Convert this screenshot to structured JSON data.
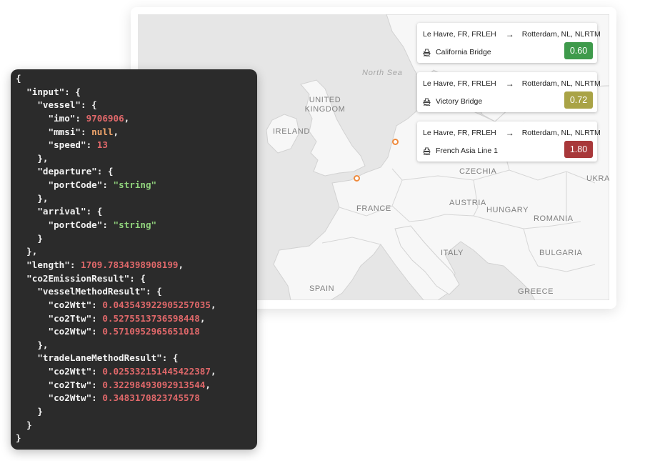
{
  "map": {
    "labels": {
      "north_sea": "North Sea",
      "united_kingdom": "UNITED KINGDOM",
      "ireland": "IRELAND",
      "france": "FRANCE",
      "spain": "SPAIN",
      "italy": "ITALY",
      "czechia": "CZECHIA",
      "austria": "AUSTRIA",
      "hungary": "HUNGARY",
      "romania": "ROMANIA",
      "bulgaria": "BULGARIA",
      "greece": "GREECE",
      "ukraine_partial": "UKRA"
    },
    "marker_color": "#ef8a3c"
  },
  "routes": [
    {
      "from": "Le Havre, FR, FRLEH",
      "arrow": "→",
      "to": "Rotterdam, NL, NLRTM",
      "vessel": "California Bridge",
      "score": "0.60",
      "score_color": "#3e9a4b",
      "icon": "ship-icon"
    },
    {
      "from": "Le Havre, FR, FRLEH",
      "arrow": "→",
      "to": "Rotterdam, NL, NLRTM",
      "vessel": "Victory Bridge",
      "score": "0.72",
      "score_color": "#a9a346",
      "icon": "ship-icon"
    },
    {
      "from": "Le Havre, FR, FRLEH",
      "arrow": "→",
      "to": "Rotterdam, NL, NLRTM",
      "vessel": "French Asia Line 1",
      "score": "1.80",
      "score_color": "#a8383a",
      "icon": "ship-icon"
    }
  ],
  "code": {
    "colors": {
      "key": "#f2f2f2",
      "number": "#e0686a",
      "string": "#8fd17c",
      "literal": "#f0a56b"
    },
    "lines": [
      [
        {
          "t": "{",
          "c": "k"
        }
      ],
      [
        {
          "t": "  \"input\": {",
          "c": "k"
        }
      ],
      [
        {
          "t": "    \"vessel\": {",
          "c": "k"
        }
      ],
      [
        {
          "t": "      \"imo\": ",
          "c": "k"
        },
        {
          "t": "9706906",
          "c": "n"
        },
        {
          "t": ",",
          "c": "k"
        }
      ],
      [
        {
          "t": "      \"mmsi\": ",
          "c": "k"
        },
        {
          "t": "null",
          "c": "l"
        },
        {
          "t": ",",
          "c": "k"
        }
      ],
      [
        {
          "t": "      \"speed\": ",
          "c": "k"
        },
        {
          "t": "13",
          "c": "n"
        }
      ],
      [
        {
          "t": "    },",
          "c": "k"
        }
      ],
      [
        {
          "t": "    \"departure\": {",
          "c": "k"
        }
      ],
      [
        {
          "t": "      \"portCode\": ",
          "c": "k"
        },
        {
          "t": "\"string\"",
          "c": "s"
        }
      ],
      [
        {
          "t": "    },",
          "c": "k"
        }
      ],
      [
        {
          "t": "    \"arrival\": {",
          "c": "k"
        }
      ],
      [
        {
          "t": "      \"portCode\": ",
          "c": "k"
        },
        {
          "t": "\"string\"",
          "c": "s"
        }
      ],
      [
        {
          "t": "    }",
          "c": "k"
        }
      ],
      [
        {
          "t": "  },",
          "c": "k"
        }
      ],
      [
        {
          "t": "  \"length\": ",
          "c": "k"
        },
        {
          "t": "1709.7834398908199",
          "c": "n"
        },
        {
          "t": ",",
          "c": "k"
        }
      ],
      [
        {
          "t": "  \"co2EmissionResult\": {",
          "c": "k"
        }
      ],
      [
        {
          "t": "    \"vesselMethodResult\": {",
          "c": "k"
        }
      ],
      [
        {
          "t": "      \"co2Wtt\": ",
          "c": "k"
        },
        {
          "t": "0.043543922905257035",
          "c": "n"
        },
        {
          "t": ",",
          "c": "k"
        }
      ],
      [
        {
          "t": "      \"co2Ttw\": ",
          "c": "k"
        },
        {
          "t": "0.5275513736598448",
          "c": "n"
        },
        {
          "t": ",",
          "c": "k"
        }
      ],
      [
        {
          "t": "      \"co2Wtw\": ",
          "c": "k"
        },
        {
          "t": "0.5710952965651018",
          "c": "n"
        }
      ],
      [
        {
          "t": "    },",
          "c": "k"
        }
      ],
      [
        {
          "t": "    \"tradeLaneMethodResult\": {",
          "c": "k"
        }
      ],
      [
        {
          "t": "      \"co2Wtt\": ",
          "c": "k"
        },
        {
          "t": "0.025332151445422387",
          "c": "n"
        },
        {
          "t": ",",
          "c": "k"
        }
      ],
      [
        {
          "t": "      \"co2Ttw\": ",
          "c": "k"
        },
        {
          "t": "0.32298493092913544",
          "c": "n"
        },
        {
          "t": ",",
          "c": "k"
        }
      ],
      [
        {
          "t": "      \"co2Wtw\": ",
          "c": "k"
        },
        {
          "t": "0.3483170823745578",
          "c": "n"
        }
      ],
      [
        {
          "t": "    }",
          "c": "k"
        }
      ],
      [
        {
          "t": "  }",
          "c": "k"
        }
      ],
      [
        {
          "t": "}",
          "c": "k"
        }
      ]
    ]
  }
}
